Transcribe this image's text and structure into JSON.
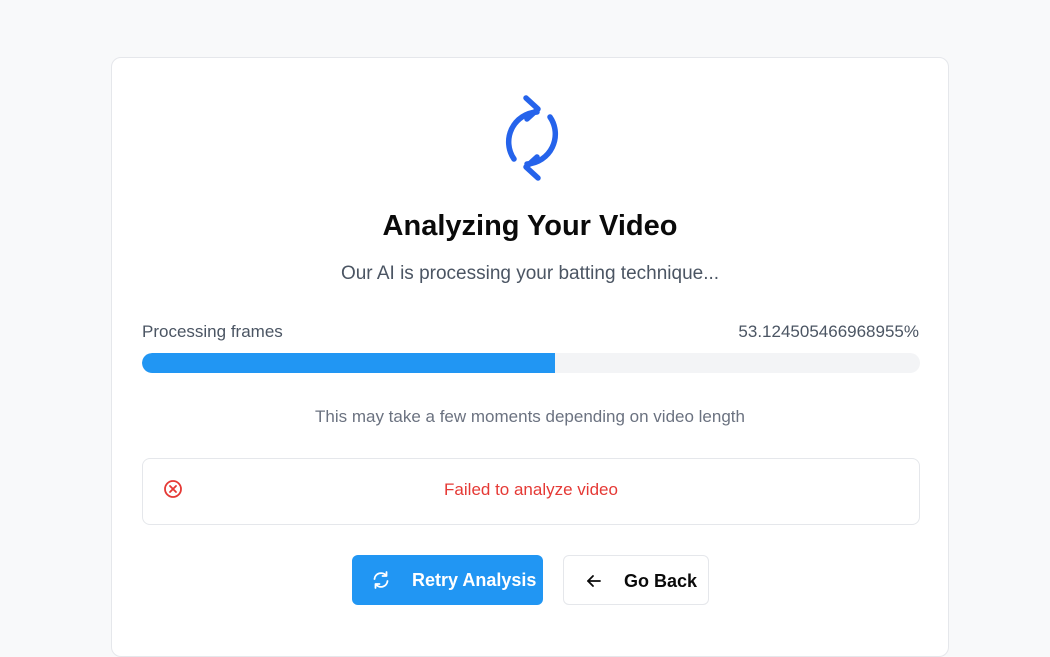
{
  "header": {
    "title": "Analyzing Your Video",
    "subtitle": "Our AI is processing your batting technique..."
  },
  "progress": {
    "label": "Processing frames",
    "value_text": "53.124505466968955%",
    "percent": 53.124505466968955
  },
  "hint": "This may take a few moments depending on video length",
  "error": {
    "message": "Failed to analyze video",
    "icon": "x-circle-icon"
  },
  "actions": {
    "retry_label": "Retry Analysis",
    "retry_icon": "refresh-icon",
    "back_label": "Go Back",
    "back_icon": "arrow-left-icon"
  },
  "colors": {
    "accent": "#2196f3",
    "spinner": "#2563eb",
    "error": "#e53935"
  }
}
